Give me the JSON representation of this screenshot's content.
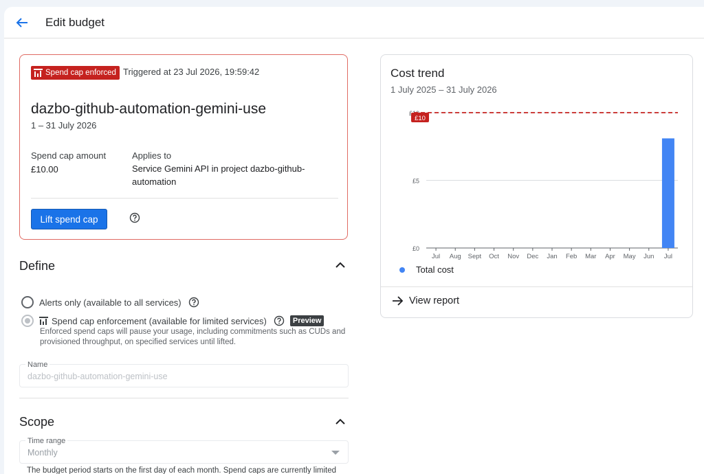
{
  "header": {
    "title": "Edit budget"
  },
  "spend_cap": {
    "badge_label": "Spend cap enforced",
    "triggered": "Triggered at 23 Jul 2026, 19:59:42",
    "budget_name": "dazbo-github-automation-gemini-use",
    "dates": "1 – 31 July 2026",
    "amount_label": "Spend cap amount",
    "amount_value": "£10.00",
    "applies_label": "Applies to",
    "applies_value": "Service Gemini API in project dazbo-github-automation",
    "lift_button": "Lift spend cap"
  },
  "define": {
    "title": "Define",
    "option_alerts": "Alerts only (available to all services)",
    "option_enforcement": "Spend cap enforcement (available for limited services)",
    "preview_badge": "Preview",
    "enforcement_desc": "Enforced spend caps will pause your usage, including commitments such as CUDs and provisioned throughput, on specified services until lifted.",
    "name_label": "Name",
    "name_value": "dazbo-github-automation-gemini-use"
  },
  "scope": {
    "title": "Scope",
    "time_range_label": "Time range",
    "time_range_value": "Monthly",
    "period_text": "The budget period starts on the first day of each month. Spend caps are currently limited"
  },
  "trend": {
    "title": "Cost trend",
    "range": "1 July 2025 – 31 July 2026",
    "legend": "Total cost",
    "view_report": "View report"
  },
  "chart_data": {
    "type": "bar",
    "categories": [
      "Jul",
      "Aug",
      "Sept",
      "Oct",
      "Nov",
      "Dec",
      "Jan",
      "Feb",
      "Mar",
      "Apr",
      "May",
      "Jun",
      "Jul"
    ],
    "series": [
      {
        "name": "Total cost",
        "values": [
          0,
          0,
          0,
          0,
          0,
          0,
          0,
          0,
          0,
          0,
          0,
          0,
          8.1
        ],
        "color": "#4285f4"
      }
    ],
    "y_ticks": [
      "£0",
      "£5",
      "£10"
    ],
    "ylim": [
      0,
      10
    ],
    "threshold": {
      "value": 10,
      "label": "£10",
      "color": "#c5221f"
    },
    "grid": true
  },
  "colors": {
    "accent": "#1a73e8",
    "alert": "#c5221f",
    "bar": "#4285f4"
  }
}
